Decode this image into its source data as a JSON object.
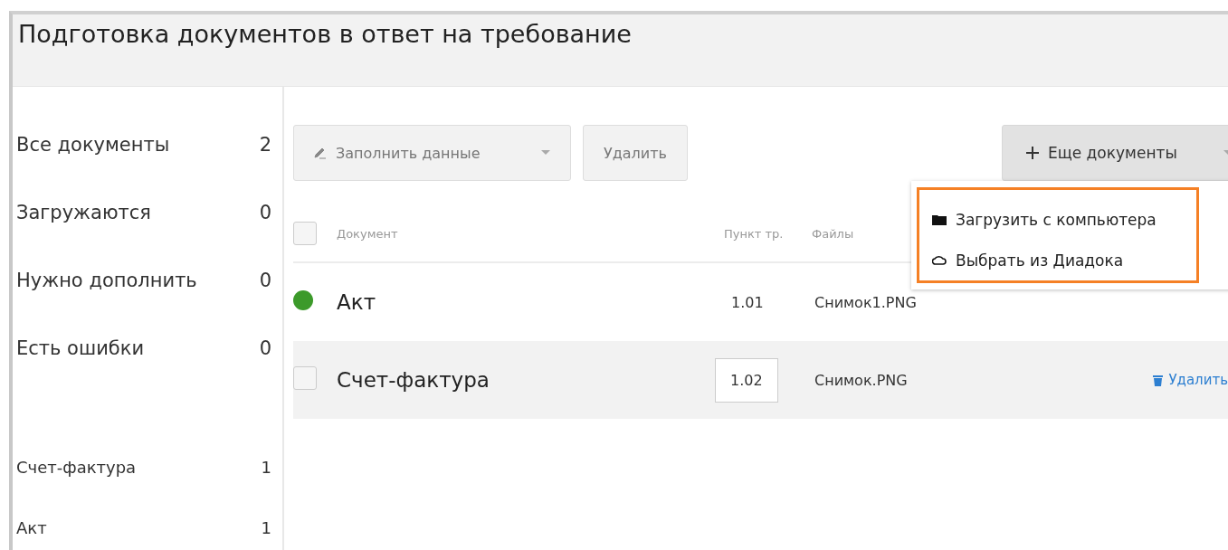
{
  "window": {
    "title": "Подготовка документов в ответ на требование"
  },
  "sidebar": {
    "filters": [
      {
        "label": "Все документы",
        "count": "2"
      },
      {
        "label": "Загружаются",
        "count": "0"
      },
      {
        "label": "Нужно дополнить",
        "count": "0"
      },
      {
        "label": "Есть ошибки",
        "count": "0"
      }
    ],
    "types": [
      {
        "label": "Счет-фактура",
        "count": "1"
      },
      {
        "label": "Акт",
        "count": "1"
      }
    ]
  },
  "toolbar": {
    "fill_button": "Заполнить данные",
    "delete_button": "Удалить",
    "more_button": "Еще документы"
  },
  "menu": {
    "items": [
      {
        "label": "Загрузить с компьютера",
        "kind": "computer"
      },
      {
        "label": "Выбрать из Диадока",
        "kind": "cloud"
      }
    ]
  },
  "table": {
    "select_all_checked": false,
    "columns": [
      "Документ",
      "Пункт тр.",
      "Файлы"
    ],
    "rows": [
      {
        "kind": "ready",
        "name": "Акт",
        "point": "1.01",
        "file": "Снимок1.PNG",
        "color": "#3c9a2a",
        "selected": false
      },
      {
        "kind": "editing",
        "name": "Счет-фактура",
        "point": "1.02",
        "file": "Снимок.PNG",
        "delete": "Удалить",
        "checked": false,
        "selected": true
      }
    ]
  }
}
